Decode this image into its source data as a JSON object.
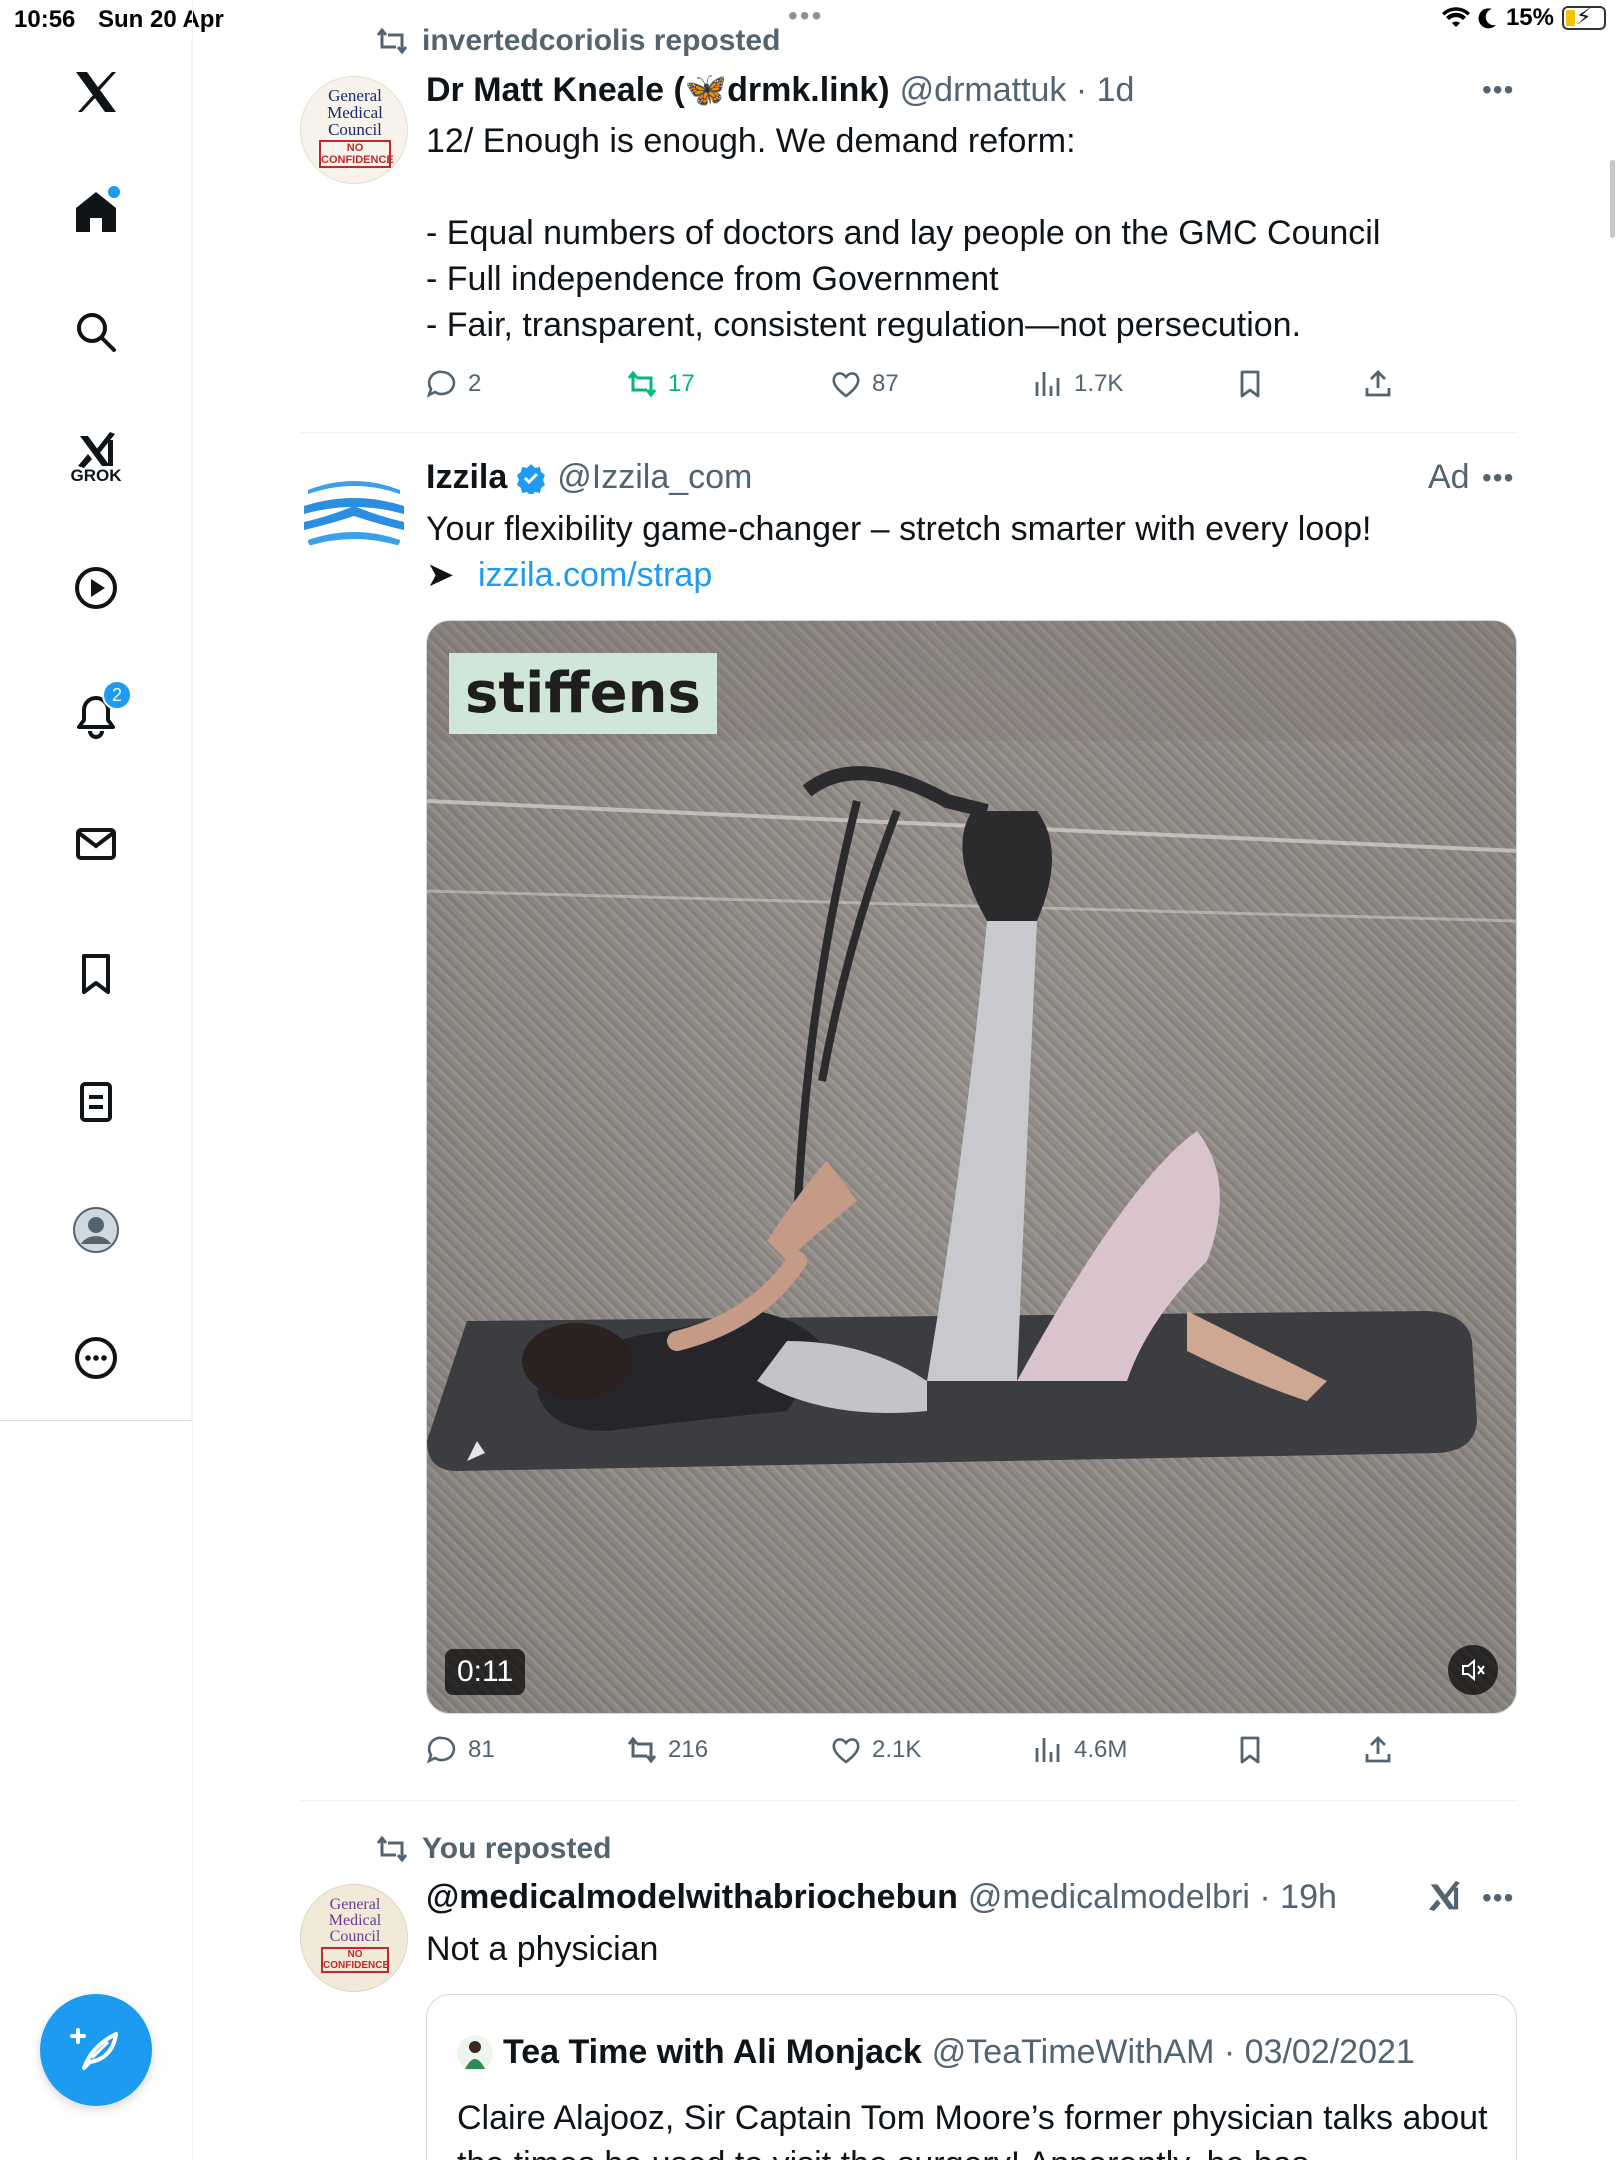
{
  "status_bar": {
    "time": "10:56",
    "date": "Sun 20 Apr",
    "battery": "15%"
  },
  "sidebar": {
    "grok_label": "GROK",
    "notifications_count": "2"
  },
  "posts": [
    {
      "repost_label": "invertedcoriolis reposted",
      "avatar_lines": [
        "General",
        "Medical",
        "Council",
        "NO",
        "CONFIDENCE"
      ],
      "name": "Dr Matt Kneale (🦋drmk.link)",
      "handle": "@drmattuk · 1d",
      "text": "12/ Enough is enough. We demand reform:\n\n- Equal numbers of doctors and lay people on the GMC Council\n- Full independence from Government\n- Fair, transparent, consistent regulation—not persecution.",
      "replies": "2",
      "reposts": "17",
      "likes": "87",
      "views": "1.7K"
    },
    {
      "name": "Izzila",
      "handle": "@Izzila_com",
      "ad_label": "Ad",
      "text": "Your flexibility game-changer – stretch smarter with every loop!",
      "link_arrow": "➤",
      "link_text": "izzila.com/strap",
      "video_caption": "stiffens",
      "video_duration": "0:11",
      "replies": "81",
      "reposts": "216",
      "likes": "2.1K",
      "views": "4.6M"
    },
    {
      "repost_label": "You reposted",
      "avatar_lines": [
        "General",
        "Medical",
        "Council",
        "NO",
        "CONFIDENCE"
      ],
      "name": "@medicalmodelwithabriochebun",
      "handle": "@medicalmodelbri · 19h",
      "text": "Not a physician",
      "quote": {
        "name": "Tea Time with Ali Monjack",
        "handle": "@TeaTimeWithAM · 03/02/2021",
        "text": "Claire Alajooz,  Sir Captain Tom Moore’s former physician talks about the times he used to visit the surgery! Apparently, he has"
      }
    }
  ],
  "colors": {
    "accent": "#1d9bf0",
    "repost_green": "#00ba7c",
    "muted": "#536471",
    "border": "#eff3f4"
  },
  "icons": [
    "x-logo-icon",
    "home-icon",
    "search-icon",
    "grok-icon",
    "video-icon",
    "bell-icon",
    "mail-icon",
    "bookmark-icon",
    "lists-icon",
    "profile-icon",
    "more-icon",
    "compose-icon",
    "reply-icon",
    "repost-icon",
    "like-icon",
    "views-icon",
    "share-icon",
    "mute-icon"
  ]
}
